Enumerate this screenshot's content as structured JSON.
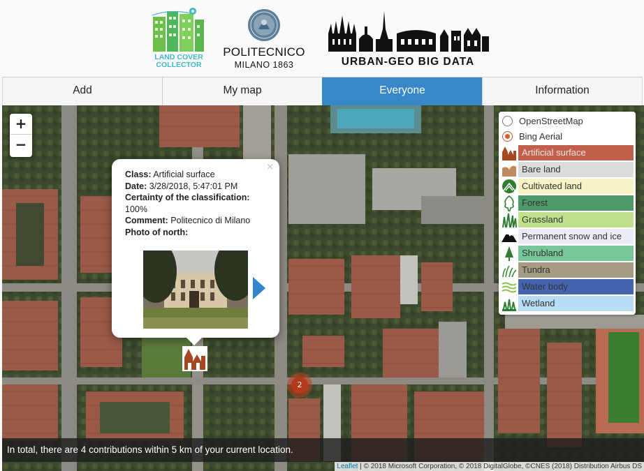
{
  "header": {
    "lcc_logo_text_line1": "LAND COVER",
    "lcc_logo_text_line2": "COLLECTOR",
    "polimi_name": "POLITECNICO",
    "polimi_sub": "MILANO 1863",
    "ugbd_text": "URBAN-GEO BIG DATA"
  },
  "tabs": [
    {
      "label": "Add"
    },
    {
      "label": "My map"
    },
    {
      "label": "Everyone",
      "active": true
    },
    {
      "label": "Information"
    }
  ],
  "zoom": {
    "in": "+",
    "out": "−"
  },
  "popup": {
    "close": "×",
    "class_label": "Class:",
    "class_value": "Artificial surface",
    "date_label": "Date:",
    "date_value": "3/28/2018, 5:47:01 PM",
    "certainty_label": "Certainty of the classification:",
    "certainty_value": "100%",
    "comment_label": "Comment:",
    "comment_value": "Politecnico di Milano",
    "photo_label": "Photo of north:",
    "next_icon": "chevron-right-icon"
  },
  "cluster": {
    "count": "2"
  },
  "layers": {
    "base": [
      {
        "label": "OpenStreetMap",
        "checked": false
      },
      {
        "label": "Bing Aerial",
        "checked": true
      }
    ],
    "classes": [
      {
        "label": "Artificial surface",
        "color": "#c0604c",
        "text_color": "#f4e4df",
        "icon": "artificial-surface-icon"
      },
      {
        "label": "Bare land",
        "color": "#dcdcdc",
        "text_color": "#333333",
        "icon": "bare-land-icon"
      },
      {
        "label": "Cultivated land",
        "color": "#f6f4c6",
        "text_color": "#333333",
        "icon": "cultivated-land-icon"
      },
      {
        "label": "Forest",
        "color": "#4e9a68",
        "text_color": "#333333",
        "icon": "forest-icon"
      },
      {
        "label": "Grassland",
        "color": "#bfe08c",
        "text_color": "#333333",
        "icon": "grassland-icon"
      },
      {
        "label": "Permanent snow and ice",
        "color": "#ececf6",
        "text_color": "#333333",
        "icon": "snow-ice-icon"
      },
      {
        "label": "Shrubland",
        "color": "#77c79b",
        "text_color": "#333333",
        "icon": "shrubland-icon"
      },
      {
        "label": "Tundra",
        "color": "#a59d83",
        "text_color": "#333333",
        "icon": "tundra-icon"
      },
      {
        "label": "Water body",
        "color": "#4465ae",
        "text_color": "#333333",
        "icon": "water-body-icon"
      },
      {
        "label": "Wetland",
        "color": "#b7dcf3",
        "text_color": "#333333",
        "icon": "wetland-icon"
      }
    ]
  },
  "infobar": {
    "text": "In total, there are 4 contributions within 5 km of your current location."
  },
  "attribution": {
    "leaflet": "Leaflet",
    "text": " | © 2018 Microsoft Corporation, © 2018 DigitalGlobe, ©CNES (2018) Distribution Airbus DS"
  }
}
